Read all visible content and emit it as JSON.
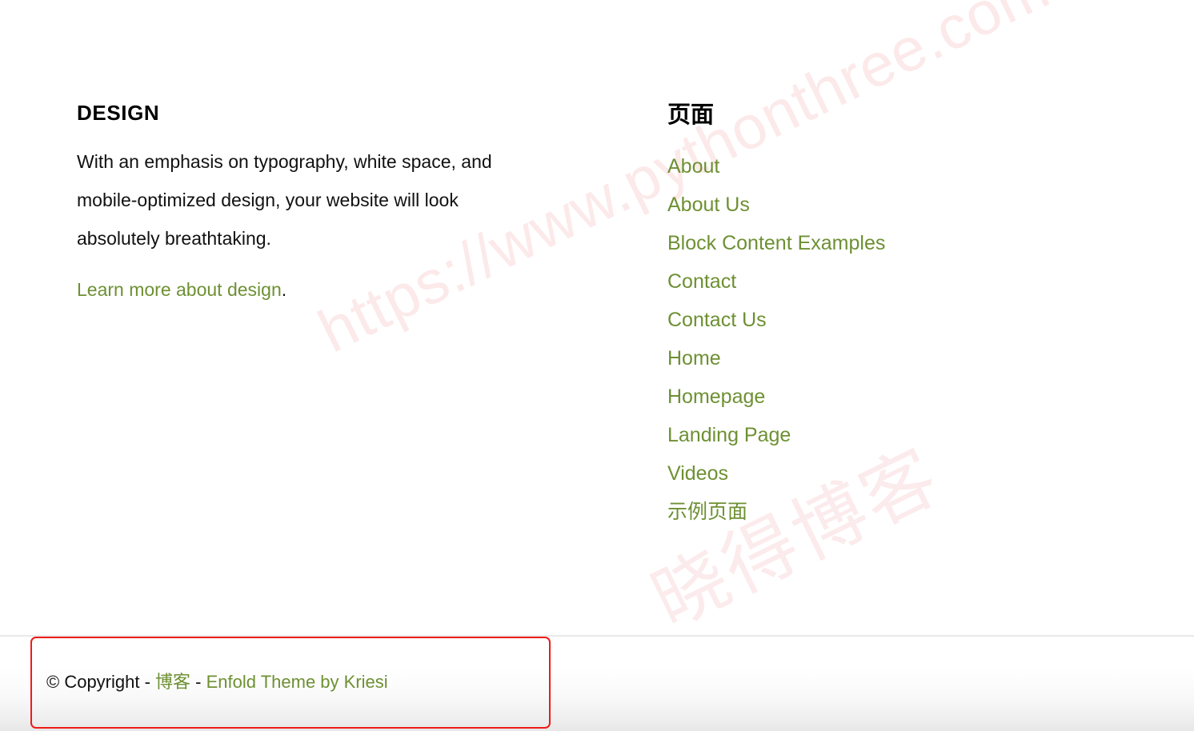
{
  "watermark": {
    "url_text": "https://www.pythonthree.com",
    "cn_text": "晓得博客",
    "color": "#fce9ea"
  },
  "theme": {
    "link_color": "#6e9033",
    "text_color": "#111111",
    "highlight_border_color": "#ee1b18",
    "divider_color": "#e9e9e9"
  },
  "widgets": {
    "design": {
      "title": "DESIGN",
      "body": "With an emphasis on typography, white space, and mobile-optimized design, your website will look absolutely breathtaking.",
      "link_label": "Learn more about design",
      "link_suffix": "."
    },
    "pages": {
      "title": "页面",
      "items": [
        {
          "label": "About",
          "cjk": false
        },
        {
          "label": "About Us",
          "cjk": false
        },
        {
          "label": "Block Content Examples",
          "cjk": false
        },
        {
          "label": "Contact",
          "cjk": false
        },
        {
          "label": "Contact Us",
          "cjk": false
        },
        {
          "label": "Home",
          "cjk": false
        },
        {
          "label": "Homepage",
          "cjk": false
        },
        {
          "label": "Landing Page",
          "cjk": false
        },
        {
          "label": "Videos",
          "cjk": false
        },
        {
          "label": "示例页面",
          "cjk": true
        }
      ]
    }
  },
  "socket": {
    "copyright_prefix": "© Copyright",
    "separator": " - ",
    "site_name": "博客",
    "theme_credit": "Enfold Theme by Kriesi"
  }
}
